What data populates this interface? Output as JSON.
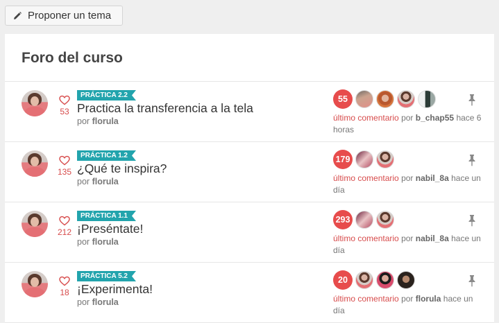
{
  "toolbar": {
    "propose_label": "Proponer un tema"
  },
  "forum": {
    "title": "Foro del curso"
  },
  "topics": [
    {
      "tag": "PRÁCTICA 2.2",
      "title": "Practica la transferencia a la tela",
      "likes": "53",
      "by_prefix": "por",
      "author": "florula",
      "comment_count": "55",
      "last_label": "último comentario",
      "last_by": "por",
      "last_user": "b_chap55",
      "last_time": "hace 6 horas",
      "participants": [
        "p1",
        "p2",
        "p3",
        "p4"
      ]
    },
    {
      "tag": "PRÁCTICA 1.2",
      "title": "¿Qué te inspira?",
      "likes": "135",
      "by_prefix": "por",
      "author": "florula",
      "comment_count": "179",
      "last_label": "último comentario",
      "last_by": "por",
      "last_user": "nabil_8a",
      "last_time": "hace un día",
      "participants": [
        "p5",
        "p3"
      ]
    },
    {
      "tag": "PRÁCTICA 1.1",
      "title": "¡Preséntate!",
      "likes": "212",
      "by_prefix": "por",
      "author": "florula",
      "comment_count": "293",
      "last_label": "último comentario",
      "last_by": "por",
      "last_user": "nabil_8a",
      "last_time": "hace un día",
      "participants": [
        "p5",
        "p3"
      ]
    },
    {
      "tag": "PRÁCTICA 5.2",
      "title": "¡Experimenta!",
      "likes": "18",
      "by_prefix": "por",
      "author": "florula",
      "comment_count": "20",
      "last_label": "último comentario",
      "last_by": "por",
      "last_user": "florula",
      "last_time": "hace un día",
      "participants": [
        "p3",
        "p6",
        "p7"
      ]
    }
  ],
  "icons": {
    "propose": "pencil-icon",
    "like": "heart-icon",
    "pin": "pin-icon"
  },
  "colors": {
    "accent_red": "#e74c4c",
    "tag_teal": "#22a4ad"
  }
}
